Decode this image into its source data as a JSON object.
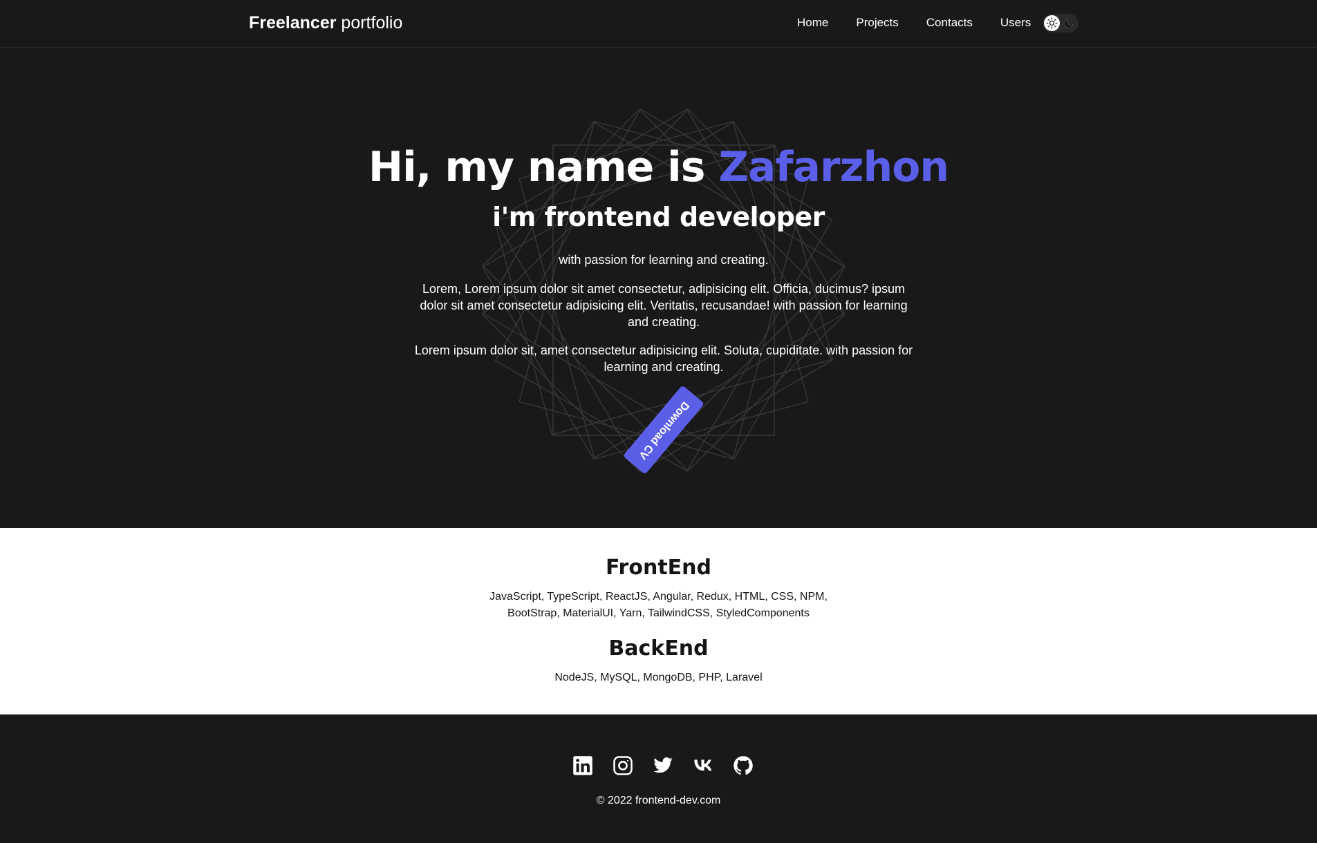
{
  "header": {
    "brand_bold": "Freelancer",
    "brand_light": "portfolio",
    "nav": [
      "Home",
      "Projects",
      "Contacts",
      "Users"
    ]
  },
  "hero": {
    "title_prefix": "Hi, my name is ",
    "title_name": "Zafarzhon",
    "subtitle": "i'm frontend developer",
    "tagline": "with passion for learning and creating.",
    "paragraph1": "Lorem, Lorem ipsum dolor sit amet consectetur, adipisicing elit. Officia, ducimus? ipsum dolor sit amet consectetur adipisicing elit. Veritatis, recusandae! with passion for learning and creating.",
    "paragraph2": "Lorem ipsum dolor sit, amet consectetur adipisicing elit. Soluta, cupiditate. with passion for learning and creating.",
    "cv_button": "Download CV"
  },
  "skills": {
    "frontend_title": "FrontEnd",
    "frontend_list": "JavaScript, TypeScript, ReactJS, Angular, Redux, HTML, CSS, NPM, BootStrap, MaterialUI, Yarn, TailwindCSS, StyledComponents",
    "backend_title": "BackEnd",
    "backend_list": "NodeJS, MySQL, MongoDB, PHP, Laravel"
  },
  "footer": {
    "social_icons": [
      "linkedin-icon",
      "instagram-icon",
      "twitter-icon",
      "vk-icon",
      "github-icon"
    ],
    "copyright": "© 2022 frontend-dev.com"
  },
  "colors": {
    "background_dark": "#191919",
    "accent": "#5b5fe8",
    "section_light": "#ffffff",
    "text_light": "#ffffff",
    "text_dark": "#151515"
  }
}
